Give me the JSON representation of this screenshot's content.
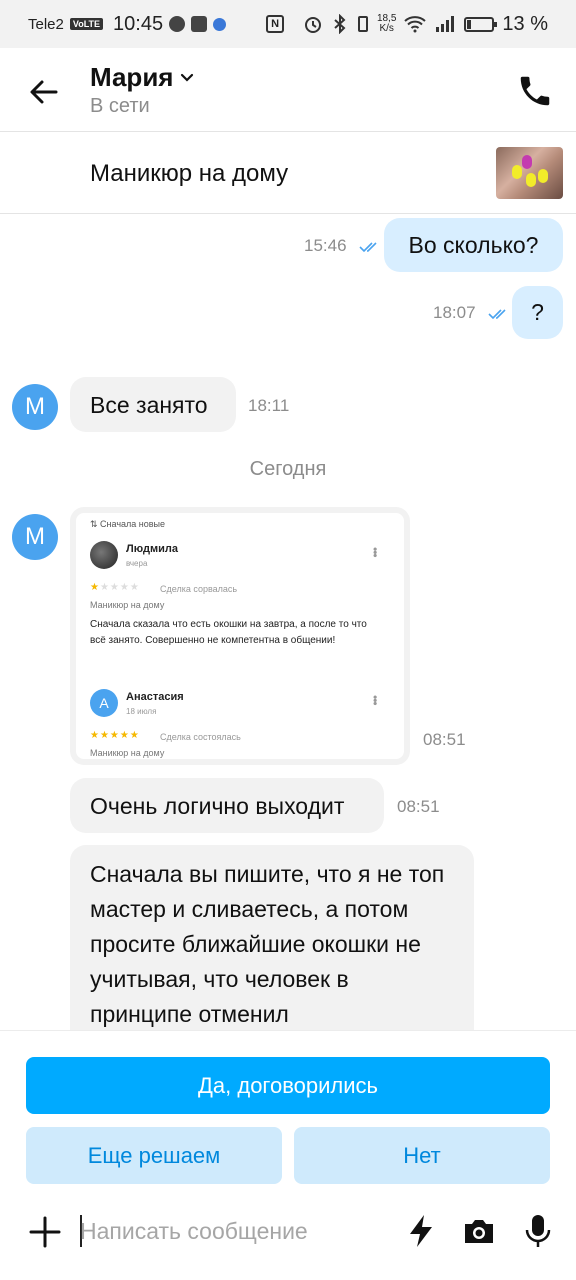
{
  "status_bar": {
    "carrier": "Tele2",
    "volte": "VoLTE",
    "time": "10:45",
    "nfc": "N",
    "net_speed_value": "18,5",
    "net_speed_unit": "K/s",
    "battery_percent": "13 %",
    "battery_level": 0.13
  },
  "header": {
    "name": "Мария",
    "status": "В сети"
  },
  "listing": {
    "title": "Маникюр на дому"
  },
  "messages": {
    "out1": {
      "text": "Во сколько?",
      "time": "15:46"
    },
    "out2": {
      "text": "?",
      "time": "18:07"
    },
    "in1": {
      "text": "Все занято",
      "time": "18:11",
      "avatar_letter": "М"
    },
    "day_separator": "Сегодня",
    "in2": {
      "time": "08:51",
      "avatar_letter": "М"
    },
    "in3": {
      "text": "Очень логично выходит",
      "time": "08:51"
    },
    "in4": {
      "text": "Сначала вы пишите, что я не топ мастер и сливаетесь, а потом просите ближайшие окошки не учитывая, что человек в принципе отменил"
    }
  },
  "attachment": {
    "sort_label": "⇅ Сначала новые",
    "review1": {
      "name": "Людмила",
      "date": "вчера",
      "stars": "★☆☆☆☆",
      "status": "Сделка сорвалась",
      "service": "Маникюр на дому",
      "text": "Сначала сказала что есть окошки на завтра, а после то что всё занято. Совершенно не компетентна в общении!"
    },
    "review2": {
      "avatar_letter": "А",
      "name": "Анастасия",
      "date": "18 июля",
      "stars": "★★★★★",
      "status": "Сделка состоялась",
      "service": "Маникюр на дому"
    }
  },
  "actions": {
    "primary": "Да, договорились",
    "undecided": "Еще решаем",
    "no": "Нет"
  },
  "composer": {
    "placeholder": "Написать сообщение"
  },
  "colors": {
    "accent": "#00aaff",
    "outgoing_bubble": "#d8eeff",
    "incoming_bubble": "#f2f2f2",
    "avatar": "#4aa3ef",
    "secondary_button": "#cfeafc",
    "secondary_button_text": "#0088dd",
    "read_ticks": "#4aa3ef",
    "star_filled": "#f5b800"
  }
}
